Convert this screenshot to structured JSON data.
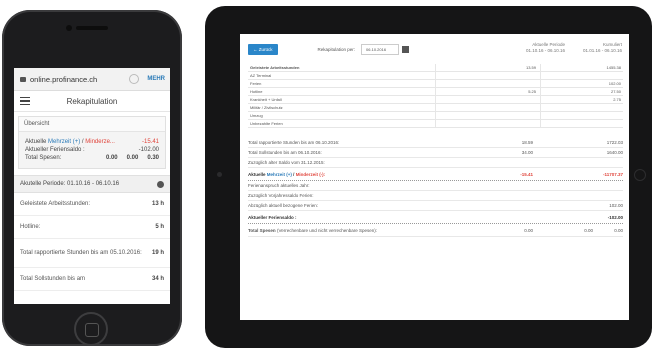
{
  "phone": {
    "url": "online.profinance.ch",
    "url_action": "MEHR",
    "app_title": "Rekapitulation",
    "overview_header": "Übersicht",
    "overview": {
      "line1_prefix": "Aktuelle",
      "line1_blue": "Mehrzeit (+)",
      "line1_sep": " / ",
      "line1_red": "Minderze...",
      "line1_value": "-15.41",
      "line2_label": "Aktueller Feriensaldo :",
      "line2_value": "-102.00",
      "line3_label": "Total Spesen:",
      "line3_v1": "0.00",
      "line3_v2": "0.00",
      "line3_v3": "0.30"
    },
    "period_label": "Akutelle Periode: 01.10.16 - 06.10.16",
    "rows": [
      {
        "label": "Geleistete Arbeitsstunden:",
        "value": "13 h"
      },
      {
        "label": "Hotline:",
        "value": "5 h"
      },
      {
        "label": "Total rapportierte Stunden bis am 05.10.2016:",
        "value": "19 h"
      },
      {
        "label": "Total Sollstunden bis am",
        "value": "34 h"
      }
    ]
  },
  "tablet": {
    "back_label": "← Zurück",
    "recap_label": "Rekapitulation per:",
    "date_value": "06.10.2016",
    "col_period_title": "Aktuelle Periode",
    "col_period_range": "01.10.16 - 06.10.16",
    "col_cumul_title": "Kumuliert",
    "col_cumul_range": "01.01.16 - 06.10.16",
    "table_rows": [
      {
        "label": "Geleistete Arbeitsstunden",
        "period": "13.59",
        "cumul": "1455.38",
        "bold": true
      },
      {
        "label": "AZ Terminal",
        "period": "",
        "cumul": "",
        "bold": false
      },
      {
        "label": "Ferien",
        "period": "",
        "cumul": "102.00",
        "bold": false
      },
      {
        "label": "Hotline",
        "period": "5.25",
        "cumul": "27.50",
        "bold": false
      },
      {
        "label": "Krankheit + Unfall",
        "period": "",
        "cumul": "2.75",
        "bold": false
      },
      {
        "label": "Militär / Zivilschutz",
        "period": "",
        "cumul": "",
        "bold": false
      },
      {
        "label": "Umzug",
        "period": "",
        "cumul": "",
        "bold": false
      },
      {
        "label": "Unbezahlte Ferien",
        "period": "",
        "cumul": "",
        "bold": false
      }
    ],
    "summary": [
      {
        "label": "Total rapportierte Stunden bis am 06.10.2016:",
        "period": "18.59",
        "cumul": "1722.03",
        "bold": false
      },
      {
        "label": "Total Sollstunden bis am 06.10.2016:",
        "period": "34.00",
        "cumul": "1640.00",
        "bold": false
      },
      {
        "label": "Zuzüglich alter Saldo vom 31.12.2015:",
        "period": "",
        "cumul": "",
        "bold": false
      }
    ],
    "mehrzeit": {
      "prefix": "Aktuelle",
      "blue": "Mehrzeit (+)",
      "sep": " / ",
      "red": "Minderzeit (-):",
      "period": "-15.41",
      "cumul": "-11707.37"
    },
    "ferien": [
      {
        "label": "Ferienanspruch aktuelles Jahr:",
        "value": ""
      },
      {
        "label": "Zuzüglich Vorjahressaldo Ferien:",
        "value": ""
      },
      {
        "label": "Abzüglich aktuell bezogene Ferien:",
        "value": "102.00"
      }
    ],
    "ferien_saldo_label": "Aktueller Feriensaldo :",
    "ferien_saldo_value": "-102.00",
    "spesen_label": "Total Spesen",
    "spesen_note": "(Verrechenbare und nicht verrechenbare Spesen):",
    "spesen_v1": "0.00",
    "spesen_v2": "0.00",
    "spesen_v3": "0.00"
  }
}
